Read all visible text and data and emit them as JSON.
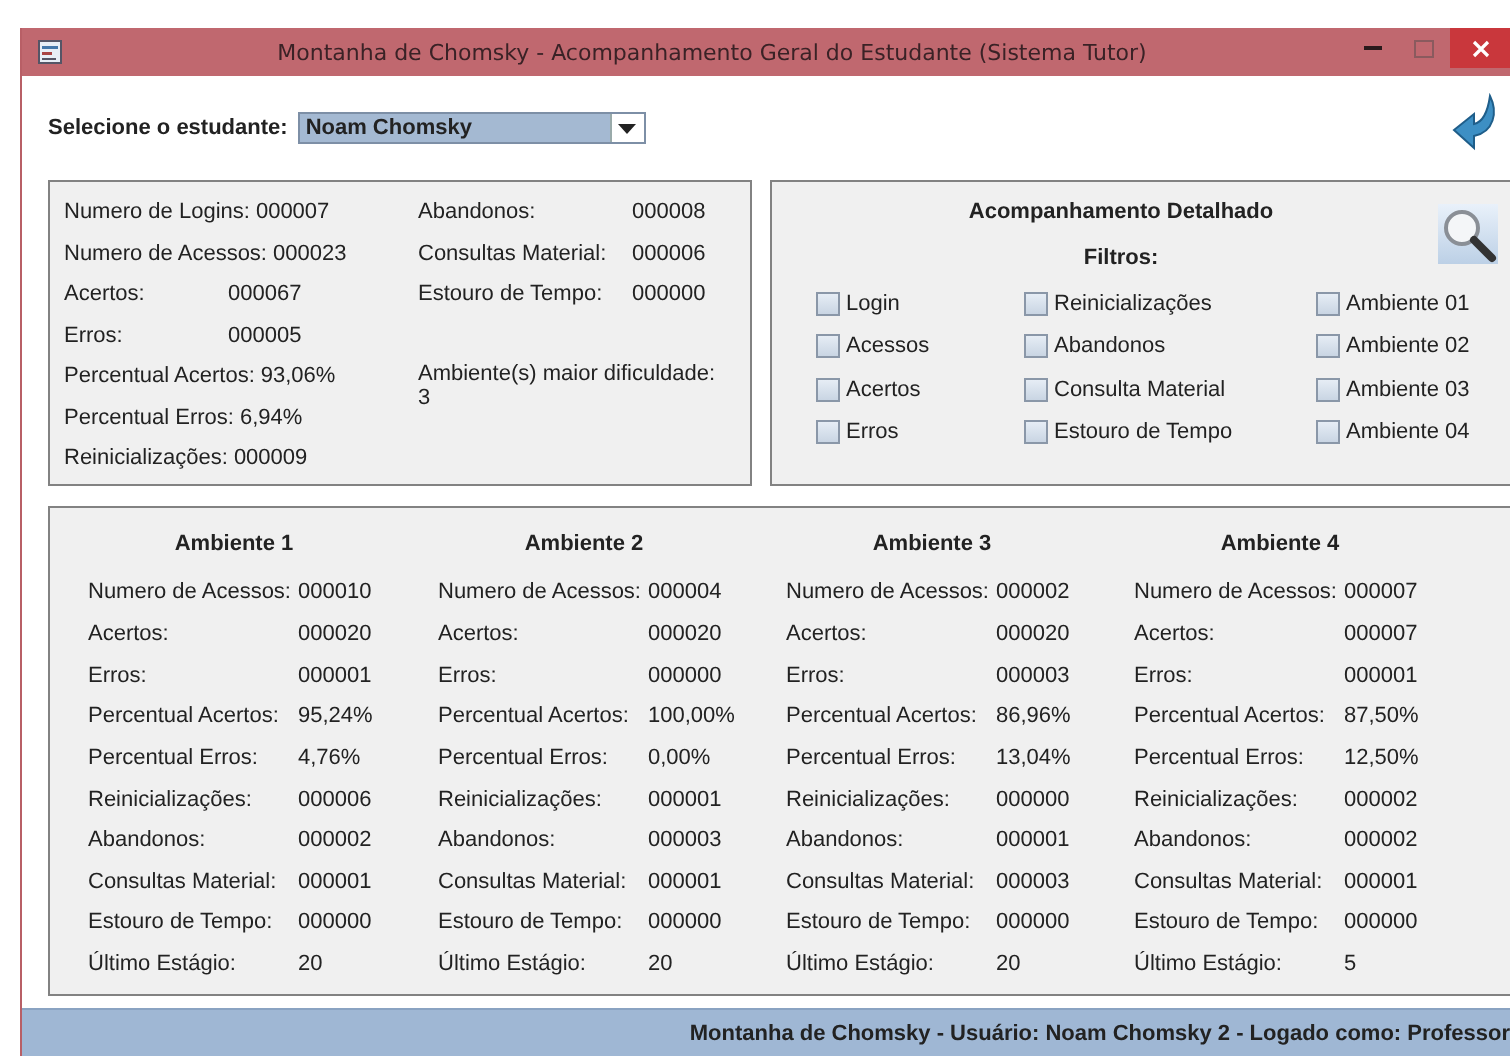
{
  "window": {
    "title": "Montanha de Chomsky - Acompanhamento Geral do Estudante (Sistema Tutor)"
  },
  "student_select": {
    "label": "Selecione o estudante:",
    "value": "Noam Chomsky"
  },
  "summary": {
    "left": [
      {
        "label": "Numero de Logins:",
        "value": "000007"
      },
      {
        "label": "Numero de Acessos:",
        "value": "000023"
      },
      {
        "label": "Acertos:",
        "value": "000067"
      },
      {
        "label": "Erros:",
        "value": "000005"
      },
      {
        "label": "Percentual Acertos:",
        "value": "93,06%"
      },
      {
        "label": "Percentual Erros:",
        "value": "6,94%"
      },
      {
        "label": "Reinicializações:",
        "value": "000009"
      }
    ],
    "right": [
      {
        "label": "Abandonos:",
        "value": "000008"
      },
      {
        "label": "Consultas Material:",
        "value": "000006"
      },
      {
        "label": "Estouro de Tempo:",
        "value": "000000"
      }
    ],
    "difficulty": {
      "label": "Ambiente(s) maior dificuldade:",
      "value": "3"
    }
  },
  "detail": {
    "title": "Acompanhamento Detalhado",
    "filters_label": "Filtros:",
    "filters": [
      {
        "label": "Login",
        "checked": false
      },
      {
        "label": "Reinicializações",
        "checked": false
      },
      {
        "label": "Ambiente 01",
        "checked": false
      },
      {
        "label": "Acessos",
        "checked": false
      },
      {
        "label": "Abandonos",
        "checked": false
      },
      {
        "label": "Ambiente 02",
        "checked": false
      },
      {
        "label": "Acertos",
        "checked": false
      },
      {
        "label": "Consulta Material",
        "checked": false
      },
      {
        "label": "Ambiente 03",
        "checked": false
      },
      {
        "label": "Erros",
        "checked": false
      },
      {
        "label": "Estouro de Tempo",
        "checked": false
      },
      {
        "label": "Ambiente 04",
        "checked": false
      }
    ]
  },
  "environments": [
    {
      "title": "Ambiente 1",
      "stats": [
        {
          "label": "Numero de Acessos:",
          "value": "000010"
        },
        {
          "label": "Acertos:",
          "value": "000020"
        },
        {
          "label": "Erros:",
          "value": "000001"
        },
        {
          "label": "Percentual Acertos:",
          "value": "95,24%"
        },
        {
          "label": "Percentual Erros:",
          "value": "4,76%"
        },
        {
          "label": "Reinicializações:",
          "value": "000006"
        },
        {
          "label": "Abandonos:",
          "value": "000002"
        },
        {
          "label": "Consultas Material:",
          "value": "000001"
        },
        {
          "label": "Estouro de Tempo:",
          "value": "000000"
        },
        {
          "label": "Último Estágio:",
          "value": "20"
        }
      ]
    },
    {
      "title": "Ambiente 2",
      "stats": [
        {
          "label": "Numero de Acessos:",
          "value": "000004"
        },
        {
          "label": "Acertos:",
          "value": "000020"
        },
        {
          "label": "Erros:",
          "value": "000000"
        },
        {
          "label": "Percentual Acertos:",
          "value": "100,00%"
        },
        {
          "label": "Percentual Erros:",
          "value": "0,00%"
        },
        {
          "label": "Reinicializações:",
          "value": "000001"
        },
        {
          "label": "Abandonos:",
          "value": "000003"
        },
        {
          "label": "Consultas Material:",
          "value": "000001"
        },
        {
          "label": "Estouro de Tempo:",
          "value": "000000"
        },
        {
          "label": "Último Estágio:",
          "value": "20"
        }
      ]
    },
    {
      "title": "Ambiente 3",
      "stats": [
        {
          "label": "Numero de Acessos:",
          "value": "000002"
        },
        {
          "label": "Acertos:",
          "value": "000020"
        },
        {
          "label": "Erros:",
          "value": "000003"
        },
        {
          "label": "Percentual Acertos:",
          "value": "86,96%"
        },
        {
          "label": "Percentual Erros:",
          "value": "13,04%"
        },
        {
          "label": "Reinicializações:",
          "value": "000000"
        },
        {
          "label": "Abandonos:",
          "value": "000001"
        },
        {
          "label": "Consultas Material:",
          "value": "000003"
        },
        {
          "label": "Estouro de Tempo:",
          "value": "000000"
        },
        {
          "label": "Último Estágio:",
          "value": "20"
        }
      ]
    },
    {
      "title": "Ambiente 4",
      "stats": [
        {
          "label": "Numero de Acessos:",
          "value": "000007"
        },
        {
          "label": "Acertos:",
          "value": "000007"
        },
        {
          "label": "Erros:",
          "value": "000001"
        },
        {
          "label": "Percentual Acertos:",
          "value": "87,50%"
        },
        {
          "label": "Percentual Erros:",
          "value": "12,50%"
        },
        {
          "label": "Reinicializações:",
          "value": "000002"
        },
        {
          "label": "Abandonos:",
          "value": "000002"
        },
        {
          "label": "Consultas Material:",
          "value": "000001"
        },
        {
          "label": "Estouro de Tempo:",
          "value": "000000"
        },
        {
          "label": "Último Estágio:",
          "value": "5"
        }
      ]
    }
  ],
  "status_bar": "Montanha de Chomsky - Usuário: Noam Chomsky 2 - Logado como: Professor"
}
